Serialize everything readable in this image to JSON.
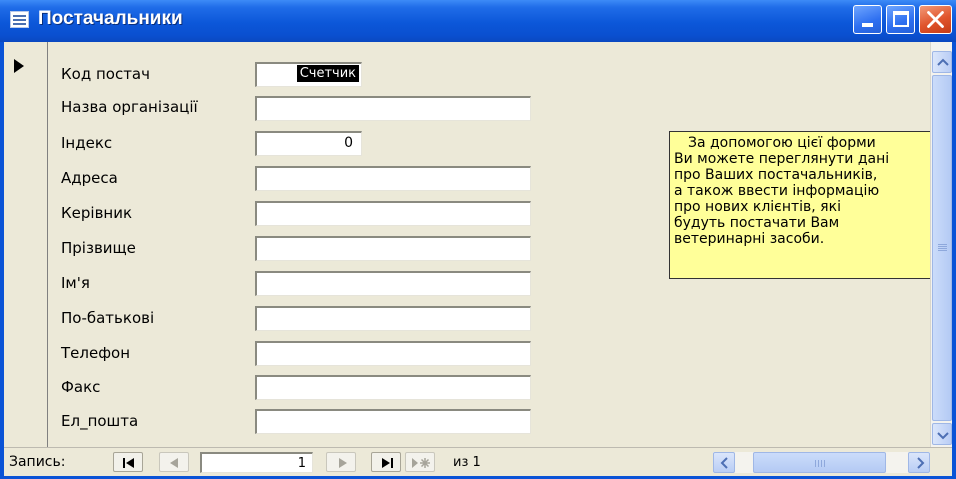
{
  "window": {
    "title": "Постачальники",
    "colors": {
      "titlebar": "#0a53d6",
      "form_background": "#ece9d8",
      "note_background": "#ffff99",
      "close_button": "#e0542c"
    }
  },
  "fields": [
    {
      "label": "Код постач",
      "value": "Счетчик",
      "kind": "counter"
    },
    {
      "label": "Назва організації",
      "value": ""
    },
    {
      "label": "Індекс",
      "value": "0",
      "kind": "short"
    },
    {
      "label": "Адреса",
      "value": ""
    },
    {
      "label": "Керівник",
      "value": ""
    },
    {
      "label": "Прізвище",
      "value": ""
    },
    {
      "label": "Ім'я",
      "value": ""
    },
    {
      "label": "По-батькові",
      "value": ""
    },
    {
      "label": "Телефон",
      "value": ""
    },
    {
      "label": "Факс",
      "value": ""
    },
    {
      "label": "Ел_пошта",
      "value": ""
    }
  ],
  "note": {
    "lines": [
      "За допомогою цієї форми",
      "Ви можете переглянути дані",
      "про Ваших постачальників,",
      "а також ввести інформацію",
      "про нових клієнтів, які",
      "будуть постачати  Вам",
      "ветеринарні засоби."
    ]
  },
  "navigation": {
    "label": "Запись:",
    "current_record": "1",
    "of_text": "из  1",
    "icons": [
      "first-record-icon",
      "previous-record-icon",
      "next-record-icon",
      "last-record-icon",
      "new-record-icon"
    ]
  }
}
